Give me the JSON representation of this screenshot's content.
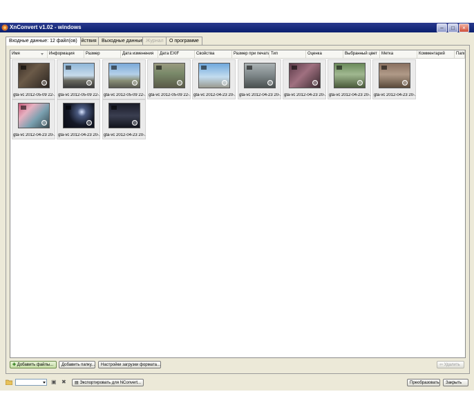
{
  "window": {
    "title": "XnConvert v1.02 - windows"
  },
  "tabs": [
    {
      "label": "Входные данные: 12 файл(ов)",
      "state": "active"
    },
    {
      "label": "Действия",
      "state": "normal"
    },
    {
      "label": "Выходные данные",
      "state": "normal"
    },
    {
      "label": "Журнал",
      "state": "disabled"
    },
    {
      "label": "О программе",
      "state": "normal"
    }
  ],
  "columns": [
    "Имя",
    "Информация",
    "Размер",
    "Дата изменения",
    "Дата EXIF",
    "Свойства",
    "Размер при печати",
    "Тип",
    "Оценка",
    "Выбранный цвет",
    "Метка",
    "Комментарий",
    "Папка"
  ],
  "files": [
    {
      "caption": "gta-vc 2012-05-09 22-...",
      "scene": "interior"
    },
    {
      "caption": "gta-vc 2012-05-09 22-...",
      "scene": "sky-car"
    },
    {
      "caption": "gta-vc 2012-05-09 22-...",
      "scene": "sky-street"
    },
    {
      "caption": "gta-vc 2012-05-09 22-...",
      "scene": "street"
    },
    {
      "caption": "gta-vc 2012-04-23 20-...",
      "scene": "sky-building"
    },
    {
      "caption": "gta-vc 2012-04-23 20-...",
      "scene": "grey-city"
    },
    {
      "caption": "gta-vc 2012-04-23 20-...",
      "scene": "alley-pink"
    },
    {
      "caption": "gta-vc 2012-04-23 20-...",
      "scene": "green-city"
    },
    {
      "caption": "gta-vc 2012-04-23 20-...",
      "scene": "brown-city"
    },
    {
      "caption": "gta-vc 2012-04-23 20-...",
      "scene": "pink-frame"
    },
    {
      "caption": "gta-vc 2012-04-23 20-...",
      "scene": "night"
    },
    {
      "caption": "gta-vc 2012-04-23 20-...",
      "scene": "night-street"
    }
  ],
  "buttons": {
    "add_files": "Добавить файлы...",
    "add_folder": "Добавить папку...",
    "load_settings": "Настройки загрузки формата...",
    "remove": "Удалить",
    "export": "Экспортировать для NConvert...",
    "convert": "Преобразовать",
    "close": "Закрыть"
  },
  "icons": {
    "folder": "folder-icon",
    "save": "save-icon",
    "delete": "delete-icon",
    "export": "export-icon",
    "app": "app-icon",
    "sort": "sort-arrow-icon"
  },
  "colors": {
    "title_bar": "#0a1f6e",
    "window_bg": "#ece9d8",
    "tile_bg": "#ebebeb",
    "add_button": "#c8dfa8"
  }
}
